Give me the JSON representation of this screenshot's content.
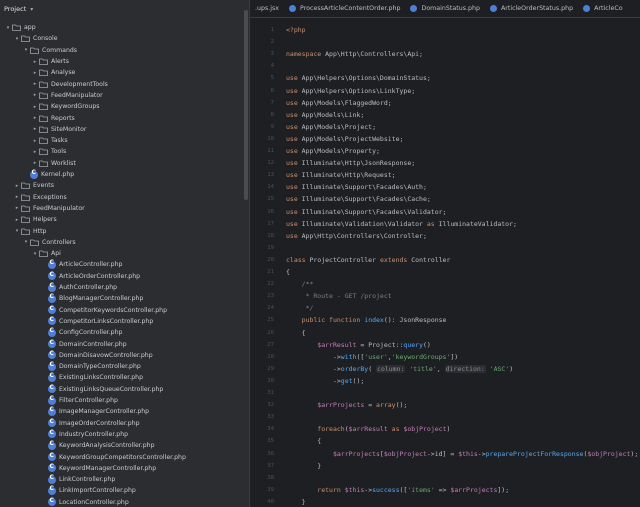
{
  "project_panel": {
    "title": "Project",
    "tree": [
      {
        "label": "app",
        "depth": 0,
        "kind": "folder",
        "arrow": "open"
      },
      {
        "label": "Console",
        "depth": 1,
        "kind": "folder",
        "arrow": "open"
      },
      {
        "label": "Commands",
        "depth": 2,
        "kind": "folder",
        "arrow": "open"
      },
      {
        "label": "Alerts",
        "depth": 3,
        "kind": "folder",
        "arrow": "closed"
      },
      {
        "label": "Analyse",
        "depth": 3,
        "kind": "folder",
        "arrow": "closed"
      },
      {
        "label": "DevelopmentTools",
        "depth": 3,
        "kind": "folder",
        "arrow": "closed"
      },
      {
        "label": "FeedManipulator",
        "depth": 3,
        "kind": "folder",
        "arrow": "closed"
      },
      {
        "label": "KeywordGroups",
        "depth": 3,
        "kind": "folder",
        "arrow": "closed"
      },
      {
        "label": "Reports",
        "depth": 3,
        "kind": "folder",
        "arrow": "closed"
      },
      {
        "label": "SiteMonitor",
        "depth": 3,
        "kind": "folder",
        "arrow": "closed"
      },
      {
        "label": "Tasks",
        "depth": 3,
        "kind": "folder",
        "arrow": "closed"
      },
      {
        "label": "Tools",
        "depth": 3,
        "kind": "folder",
        "arrow": "closed"
      },
      {
        "label": "Worklist",
        "depth": 3,
        "kind": "folder",
        "arrow": "closed"
      },
      {
        "label": "Kernel.php",
        "depth": 2,
        "kind": "class",
        "arrow": "none"
      },
      {
        "label": "Events",
        "depth": 1,
        "kind": "folder",
        "arrow": "closed"
      },
      {
        "label": "Exceptions",
        "depth": 1,
        "kind": "folder",
        "arrow": "closed"
      },
      {
        "label": "FeedManipulator",
        "depth": 1,
        "kind": "folder",
        "arrow": "closed"
      },
      {
        "label": "Helpers",
        "depth": 1,
        "kind": "folder",
        "arrow": "closed"
      },
      {
        "label": "Http",
        "depth": 1,
        "kind": "folder",
        "arrow": "open"
      },
      {
        "label": "Controllers",
        "depth": 2,
        "kind": "folder",
        "arrow": "open"
      },
      {
        "label": "Api",
        "depth": 3,
        "kind": "folder",
        "arrow": "open"
      },
      {
        "label": "ArticleController.php",
        "depth": 4,
        "kind": "class",
        "arrow": "none"
      },
      {
        "label": "ArticleOrderController.php",
        "depth": 4,
        "kind": "class",
        "arrow": "none"
      },
      {
        "label": "AuthController.php",
        "depth": 4,
        "kind": "class",
        "arrow": "none"
      },
      {
        "label": "BlogManagerController.php",
        "depth": 4,
        "kind": "class",
        "arrow": "none"
      },
      {
        "label": "CompetitorKeywordsController.php",
        "depth": 4,
        "kind": "class",
        "arrow": "none"
      },
      {
        "label": "CompetitorLinksController.php",
        "depth": 4,
        "kind": "class",
        "arrow": "none"
      },
      {
        "label": "ConfigController.php",
        "depth": 4,
        "kind": "class",
        "arrow": "none"
      },
      {
        "label": "DomainController.php",
        "depth": 4,
        "kind": "class",
        "arrow": "none"
      },
      {
        "label": "DomainDisavowController.php",
        "depth": 4,
        "kind": "class",
        "arrow": "none"
      },
      {
        "label": "DomainTypeController.php",
        "depth": 4,
        "kind": "class",
        "arrow": "none"
      },
      {
        "label": "ExistingLinksController.php",
        "depth": 4,
        "kind": "class",
        "arrow": "none"
      },
      {
        "label": "ExistingLinksQueueController.php",
        "depth": 4,
        "kind": "class",
        "arrow": "none"
      },
      {
        "label": "FilterController.php",
        "depth": 4,
        "kind": "class",
        "arrow": "none"
      },
      {
        "label": "ImageManagerController.php",
        "depth": 4,
        "kind": "class",
        "arrow": "none"
      },
      {
        "label": "ImageOrderController.php",
        "depth": 4,
        "kind": "class",
        "arrow": "none"
      },
      {
        "label": "IndustryController.php",
        "depth": 4,
        "kind": "class",
        "arrow": "none"
      },
      {
        "label": "KeywordAnalysisController.php",
        "depth": 4,
        "kind": "class",
        "arrow": "none"
      },
      {
        "label": "KeywordGroupCompetitorsController.php",
        "depth": 4,
        "kind": "class",
        "arrow": "none"
      },
      {
        "label": "KeywordManagerController.php",
        "depth": 4,
        "kind": "class",
        "arrow": "none"
      },
      {
        "label": "LinkController.php",
        "depth": 4,
        "kind": "class",
        "arrow": "none"
      },
      {
        "label": "LinkImportController.php",
        "depth": 4,
        "kind": "class",
        "arrow": "none"
      },
      {
        "label": "LocationController.php",
        "depth": 4,
        "kind": "class",
        "arrow": "none"
      }
    ]
  },
  "editor": {
    "tabs": [
      {
        "label": ".ups.jsx",
        "icon": "none"
      },
      {
        "label": "ProcessArticleContentOrder.php",
        "icon": "class-icon"
      },
      {
        "label": "DomainStatus.php",
        "icon": "class-icon"
      },
      {
        "label": "ArticleOrderStatus.php",
        "icon": "class-icon"
      },
      {
        "label": "ArticleCo",
        "icon": "class-icon"
      }
    ],
    "line_numbers": [
      "1",
      "2",
      "3",
      "4",
      "5",
      "6",
      "7",
      "8",
      "9",
      "10",
      "11",
      "12",
      "13",
      "14",
      "15",
      "16",
      "17",
      "18",
      "19",
      "20",
      "21",
      "22",
      "23",
      "24",
      "25",
      "26",
      "27",
      "28",
      "29",
      "30",
      "31",
      "32",
      "33",
      "34",
      "35",
      "36",
      "37",
      "38",
      "39",
      "40",
      "41"
    ],
    "code_lines": [
      [
        {
          "t": "<?php",
          "c": "kw"
        }
      ],
      [],
      [
        {
          "t": "namespace ",
          "c": "kw"
        },
        {
          "t": "App\\Http\\Controllers\\Api;",
          "c": "cls"
        }
      ],
      [],
      [
        {
          "t": "use ",
          "c": "kw"
        },
        {
          "t": "App\\Helpers\\Options\\DomainStatus;",
          "c": "cls"
        }
      ],
      [
        {
          "t": "use ",
          "c": "kw"
        },
        {
          "t": "App\\Helpers\\Options\\LinkType;",
          "c": "cls"
        }
      ],
      [
        {
          "t": "use ",
          "c": "kw"
        },
        {
          "t": "App\\Models\\FlaggedWord;",
          "c": "cls"
        }
      ],
      [
        {
          "t": "use ",
          "c": "kw"
        },
        {
          "t": "App\\Models\\Link;",
          "c": "cls"
        }
      ],
      [
        {
          "t": "use ",
          "c": "kw"
        },
        {
          "t": "App\\Models\\Project;",
          "c": "cls"
        }
      ],
      [
        {
          "t": "use ",
          "c": "kw"
        },
        {
          "t": "App\\Models\\ProjectWebsite;",
          "c": "cls"
        }
      ],
      [
        {
          "t": "use ",
          "c": "kw"
        },
        {
          "t": "App\\Models\\Property;",
          "c": "cls"
        }
      ],
      [
        {
          "t": "use ",
          "c": "kw"
        },
        {
          "t": "Illuminate\\Http\\JsonResponse;",
          "c": "cls"
        }
      ],
      [
        {
          "t": "use ",
          "c": "kw"
        },
        {
          "t": "Illuminate\\Http\\Request;",
          "c": "cls"
        }
      ],
      [
        {
          "t": "use ",
          "c": "kw"
        },
        {
          "t": "Illuminate\\Support\\Facades\\Auth;",
          "c": "cls"
        }
      ],
      [
        {
          "t": "use ",
          "c": "kw"
        },
        {
          "t": "Illuminate\\Support\\Facades\\Cache;",
          "c": "cls"
        }
      ],
      [
        {
          "t": "use ",
          "c": "kw"
        },
        {
          "t": "Illuminate\\Support\\Facades\\Validator;",
          "c": "cls"
        }
      ],
      [
        {
          "t": "use ",
          "c": "kw"
        },
        {
          "t": "Illuminate\\Validation\\Validator ",
          "c": "cls"
        },
        {
          "t": "as ",
          "c": "kw"
        },
        {
          "t": "IlluminateValidator;",
          "c": "cls"
        }
      ],
      [
        {
          "t": "use ",
          "c": "kw"
        },
        {
          "t": "App\\Http\\Controllers\\Controller;",
          "c": "cls"
        }
      ],
      [],
      [
        {
          "t": "class ",
          "c": "kw"
        },
        {
          "t": "ProjectController ",
          "c": "cls"
        },
        {
          "t": "extends ",
          "c": "kw"
        },
        {
          "t": "Controller",
          "c": "cls"
        }
      ],
      [
        {
          "t": "{",
          "c": "cls"
        }
      ],
      [
        {
          "t": "    /**",
          "c": "cmt"
        }
      ],
      [
        {
          "t": "     * Route - GET /project",
          "c": "cmt"
        }
      ],
      [
        {
          "t": "     */",
          "c": "cmt"
        }
      ],
      [
        {
          "t": "    public function ",
          "c": "kw"
        },
        {
          "t": "index",
          "c": "fn"
        },
        {
          "t": "(): JsonResponse",
          "c": "cls"
        }
      ],
      [
        {
          "t": "    {",
          "c": "cls"
        }
      ],
      [
        {
          "t": "        $arrResult",
          "c": "var"
        },
        {
          "t": " = Project::",
          "c": "cls"
        },
        {
          "t": "query",
          "c": "fn"
        },
        {
          "t": "()",
          "c": "cls"
        }
      ],
      [
        {
          "t": "            ->",
          "c": "cls"
        },
        {
          "t": "with",
          "c": "fn"
        },
        {
          "t": "([",
          "c": "cls"
        },
        {
          "t": "'user'",
          "c": "str"
        },
        {
          "t": ",",
          "c": "cls"
        },
        {
          "t": "'keywordGroups'",
          "c": "str"
        },
        {
          "t": "])",
          "c": "cls"
        }
      ],
      [
        {
          "t": "            ->",
          "c": "cls"
        },
        {
          "t": "orderBy",
          "c": "fn"
        },
        {
          "t": "( ",
          "c": "cls"
        },
        {
          "t": "column:",
          "c": "hint"
        },
        {
          "t": " ",
          "c": "cls"
        },
        {
          "t": "'title'",
          "c": "str"
        },
        {
          "t": ", ",
          "c": "cls"
        },
        {
          "t": "direction:",
          "c": "hint"
        },
        {
          "t": " ",
          "c": "cls"
        },
        {
          "t": "'ASC'",
          "c": "str"
        },
        {
          "t": ")",
          "c": "cls"
        }
      ],
      [
        {
          "t": "            ->",
          "c": "cls"
        },
        {
          "t": "get",
          "c": "fn"
        },
        {
          "t": "();",
          "c": "cls"
        }
      ],
      [],
      [
        {
          "t": "        $arrProjects",
          "c": "var"
        },
        {
          "t": " = ",
          "c": "cls"
        },
        {
          "t": "array",
          "c": "kw"
        },
        {
          "t": "();",
          "c": "cls"
        }
      ],
      [],
      [
        {
          "t": "        foreach",
          "c": "kw"
        },
        {
          "t": "(",
          "c": "cls"
        },
        {
          "t": "$arrResult",
          "c": "var"
        },
        {
          "t": " as ",
          "c": "kw"
        },
        {
          "t": "$objProject",
          "c": "var"
        },
        {
          "t": ")",
          "c": "cls"
        }
      ],
      [
        {
          "t": "        {",
          "c": "cls"
        }
      ],
      [
        {
          "t": "            $arrProjects",
          "c": "var"
        },
        {
          "t": "[",
          "c": "cls"
        },
        {
          "t": "$objProject",
          "c": "var"
        },
        {
          "t": "->id] = ",
          "c": "cls"
        },
        {
          "t": "$this",
          "c": "var"
        },
        {
          "t": "->",
          "c": "cls"
        },
        {
          "t": "prepareProjectForResponse",
          "c": "fn"
        },
        {
          "t": "(",
          "c": "cls"
        },
        {
          "t": "$objProject",
          "c": "var"
        },
        {
          "t": ");",
          "c": "cls"
        }
      ],
      [
        {
          "t": "        }",
          "c": "cls"
        }
      ],
      [],
      [
        {
          "t": "        return ",
          "c": "kw"
        },
        {
          "t": "$this",
          "c": "var"
        },
        {
          "t": "->",
          "c": "cls"
        },
        {
          "t": "success",
          "c": "fn"
        },
        {
          "t": "([",
          "c": "cls"
        },
        {
          "t": "'items'",
          "c": "str"
        },
        {
          "t": " => ",
          "c": "cls"
        },
        {
          "t": "$arrProjects",
          "c": "var"
        },
        {
          "t": "]);",
          "c": "cls"
        }
      ],
      [
        {
          "t": "    }",
          "c": "cls"
        }
      ],
      []
    ]
  },
  "colors": {
    "panel_bg": "#2b2d30",
    "editor_bg": "#1e1f22",
    "keyword": "#cf8e6d",
    "function": "#56a8f5",
    "string": "#6aab73",
    "variable": "#c77dbb",
    "comment": "#7a7e85"
  }
}
